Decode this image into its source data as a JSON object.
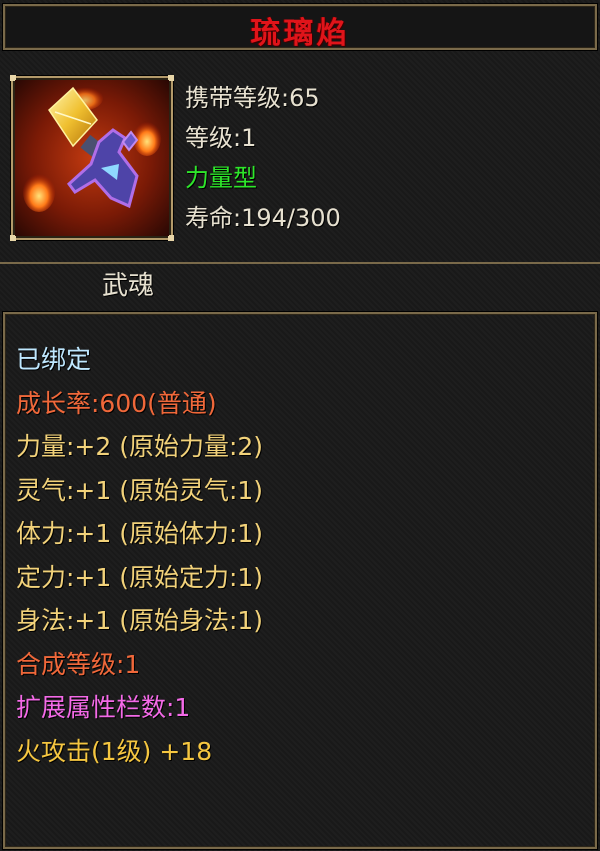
{
  "item": {
    "name": "琉璃焰",
    "icon": "weapon-spirit-icon",
    "carry_level": "携带等级:65",
    "level": "等级:1",
    "type": "力量型",
    "lifespan": "寿命:194/300",
    "category": "武魂"
  },
  "stats": [
    {
      "text": "已绑定",
      "color": "#bfe8ff"
    },
    {
      "text": "成长率:600(普通)",
      "color": "#f0683a"
    },
    {
      "text": "力量:+2 (原始力量:2)",
      "color": "#f2d27a"
    },
    {
      "text": "灵气:+1 (原始灵气:1)",
      "color": "#f2d27a"
    },
    {
      "text": "体力:+1 (原始体力:1)",
      "color": "#f2d27a"
    },
    {
      "text": "定力:+1 (原始定力:1)",
      "color": "#f2d27a"
    },
    {
      "text": "身法:+1 (原始身法:1)",
      "color": "#f2d27a"
    },
    {
      "text": "合成等级:1",
      "color": "#f0683a"
    },
    {
      "text": "扩展属性栏数:1",
      "color": "#f46ae8"
    },
    {
      "text": "火攻击(1级) +18",
      "color": "#f5c640"
    }
  ],
  "colors": {
    "title": "#e0141a",
    "border": "#7a6a4a",
    "type": "#2ee62a"
  }
}
